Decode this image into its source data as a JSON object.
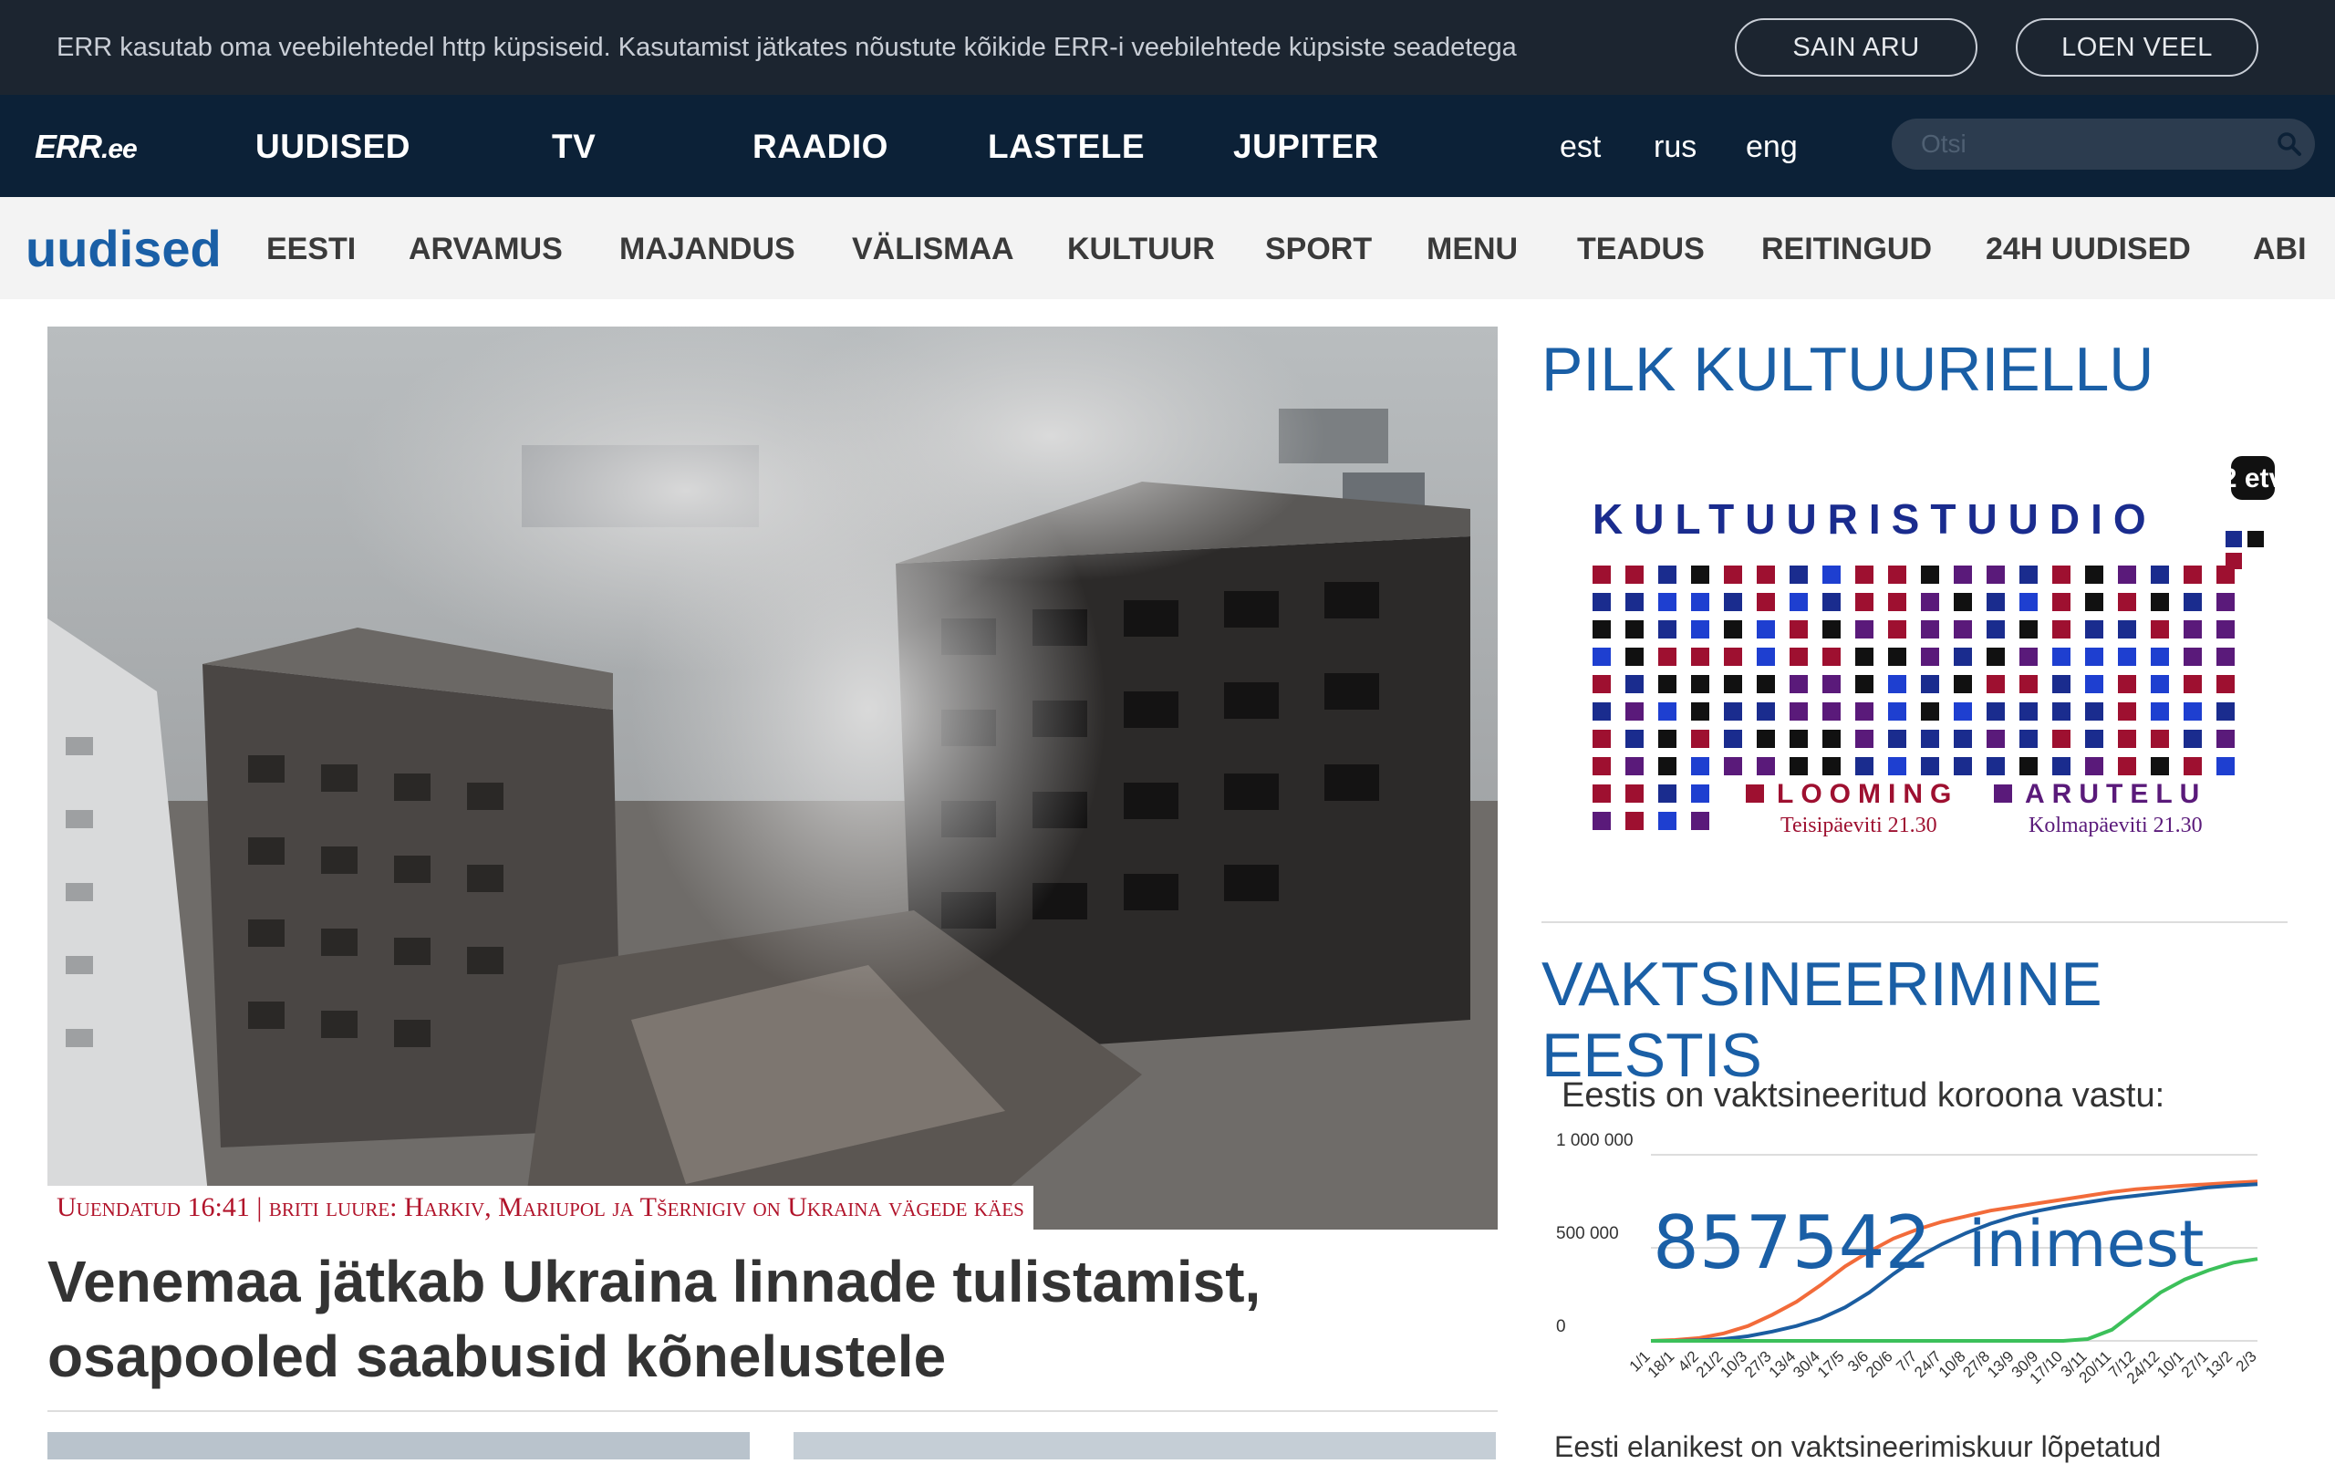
{
  "cookie": {
    "message": "ERR kasutab oma veebilehtedel http küpsiseid. Kasutamist jätkates nõustute kõikide ERR-i veebilehtede küpsiste seadetega",
    "accept_label": "SAIN ARU",
    "more_label": "LOEN VEEL"
  },
  "topnav": {
    "logo": "ERR",
    "logo_suffix": ".ee",
    "links": [
      "UUDISED",
      "TV",
      "RAADIO",
      "LASTELE",
      "JUPITER"
    ],
    "languages": [
      "est",
      "rus",
      "eng"
    ],
    "search_placeholder": "Otsi",
    "search_icon": "search-icon"
  },
  "subnav": {
    "brand": "uudised",
    "items": [
      "EESTI",
      "ARVAMUS",
      "MAJANDUS",
      "VÄLISMAA",
      "KULTUUR",
      "SPORT",
      "MENU",
      "TEADUS",
      "REITINGUD",
      "24H UUDISED",
      "ABI"
    ]
  },
  "hero": {
    "caption": "Uuendatud 16:41 | briti luure: Harkiv, Mariupol ja Tšernigiv on Ukraina vägede käes",
    "headline": "Venemaa jätkab Ukraina linnade tulistamist, osapooled saabusid kõnelustele"
  },
  "sidebar": {
    "culture_heading": "PILK KULTUURIELLU",
    "culture_banner": {
      "title": "KULTUURISTUUDIO",
      "channel": "2 etv",
      "show1": "LOOMING",
      "show1_time": "Teisipäeviti 21.30",
      "show2": "ARUTELU",
      "show2_time": "Kolmapäeviti 21.30"
    },
    "vaccine_heading": "VAKTSINEERIMINE EESTIS",
    "vaccine_subtitle": "Eestis on vaktsineeritud koroona vastu:",
    "vaccine_count": "857542",
    "vaccine_unit": "inimest",
    "vaccine_bottom": "Eesti elanikest on vaktsineerimiskuur lõpetatud"
  },
  "chart_data": {
    "type": "line",
    "title": "",
    "y_ticks": [
      "1 000 000",
      "500 000",
      "0"
    ],
    "ylim": [
      0,
      1000000
    ],
    "categories": [
      "1/1",
      "18/1",
      "4/2",
      "21/2",
      "10/3",
      "27/3",
      "13/4",
      "30/4",
      "17/5",
      "3/6",
      "20/6",
      "7/7",
      "24/7",
      "10/8",
      "27/8",
      "13/9",
      "30/9",
      "17/10",
      "3/11",
      "20/11",
      "7/12",
      "24/12",
      "10/1",
      "27/1",
      "13/2",
      "2/3"
    ],
    "series": [
      {
        "color": "#f26b3a",
        "values": [
          0,
          5000,
          15000,
          40000,
          80000,
          140000,
          210000,
          300000,
          400000,
          480000,
          550000,
          600000,
          640000,
          670000,
          700000,
          720000,
          740000,
          760000,
          780000,
          800000,
          815000,
          825000,
          835000,
          842000,
          850000,
          857000
        ]
      },
      {
        "color": "#1b5da0",
        "values": [
          0,
          0,
          3000,
          10000,
          25000,
          50000,
          80000,
          120000,
          180000,
          260000,
          360000,
          450000,
          520000,
          580000,
          630000,
          670000,
          700000,
          725000,
          745000,
          765000,
          780000,
          795000,
          810000,
          825000,
          835000,
          842000
        ]
      },
      {
        "color": "#3cc05a",
        "values": [
          0,
          0,
          0,
          0,
          0,
          0,
          0,
          0,
          0,
          0,
          0,
          0,
          0,
          0,
          0,
          0,
          0,
          0,
          10000,
          60000,
          160000,
          260000,
          330000,
          380000,
          420000,
          440000
        ]
      }
    ],
    "grid": true
  }
}
